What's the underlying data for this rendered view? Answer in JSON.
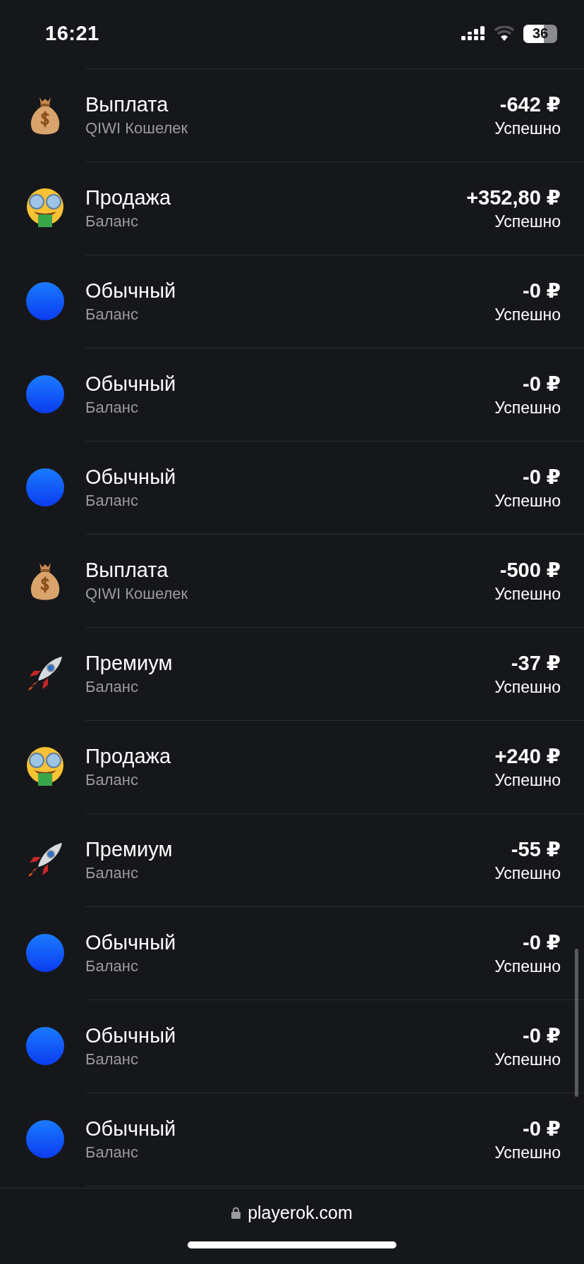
{
  "status_bar": {
    "time": "16:21",
    "battery": "36"
  },
  "transactions": [
    {
      "kind": "bag",
      "title": "Выплата",
      "source": "QIWI Кошелек",
      "amount": "-642 ₽",
      "status": "Успешно"
    },
    {
      "kind": "money-face",
      "title": "Продажа",
      "source": "Баланс",
      "amount": "+352,80 ₽",
      "status": "Успешно"
    },
    {
      "kind": "circle",
      "title": "Обычный",
      "source": "Баланс",
      "amount": "-0 ₽",
      "status": "Успешно"
    },
    {
      "kind": "circle",
      "title": "Обычный",
      "source": "Баланс",
      "amount": "-0 ₽",
      "status": "Успешно"
    },
    {
      "kind": "circle",
      "title": "Обычный",
      "source": "Баланс",
      "amount": "-0 ₽",
      "status": "Успешно"
    },
    {
      "kind": "bag",
      "title": "Выплата",
      "source": "QIWI Кошелек",
      "amount": "-500 ₽",
      "status": "Успешно"
    },
    {
      "kind": "rocket",
      "title": "Премиум",
      "source": "Баланс",
      "amount": "-37 ₽",
      "status": "Успешно"
    },
    {
      "kind": "money-face",
      "title": "Продажа",
      "source": "Баланс",
      "amount": "+240 ₽",
      "status": "Успешно"
    },
    {
      "kind": "rocket",
      "title": "Премиум",
      "source": "Баланс",
      "amount": "-55 ₽",
      "status": "Успешно"
    },
    {
      "kind": "circle",
      "title": "Обычный",
      "source": "Баланс",
      "amount": "-0 ₽",
      "status": "Успешно"
    },
    {
      "kind": "circle",
      "title": "Обычный",
      "source": "Баланс",
      "amount": "-0 ₽",
      "status": "Успешно"
    },
    {
      "kind": "circle",
      "title": "Обычный",
      "source": "Баланс",
      "amount": "-0 ₽",
      "status": "Успешно"
    }
  ],
  "address_bar": {
    "url": "playerok.com"
  }
}
